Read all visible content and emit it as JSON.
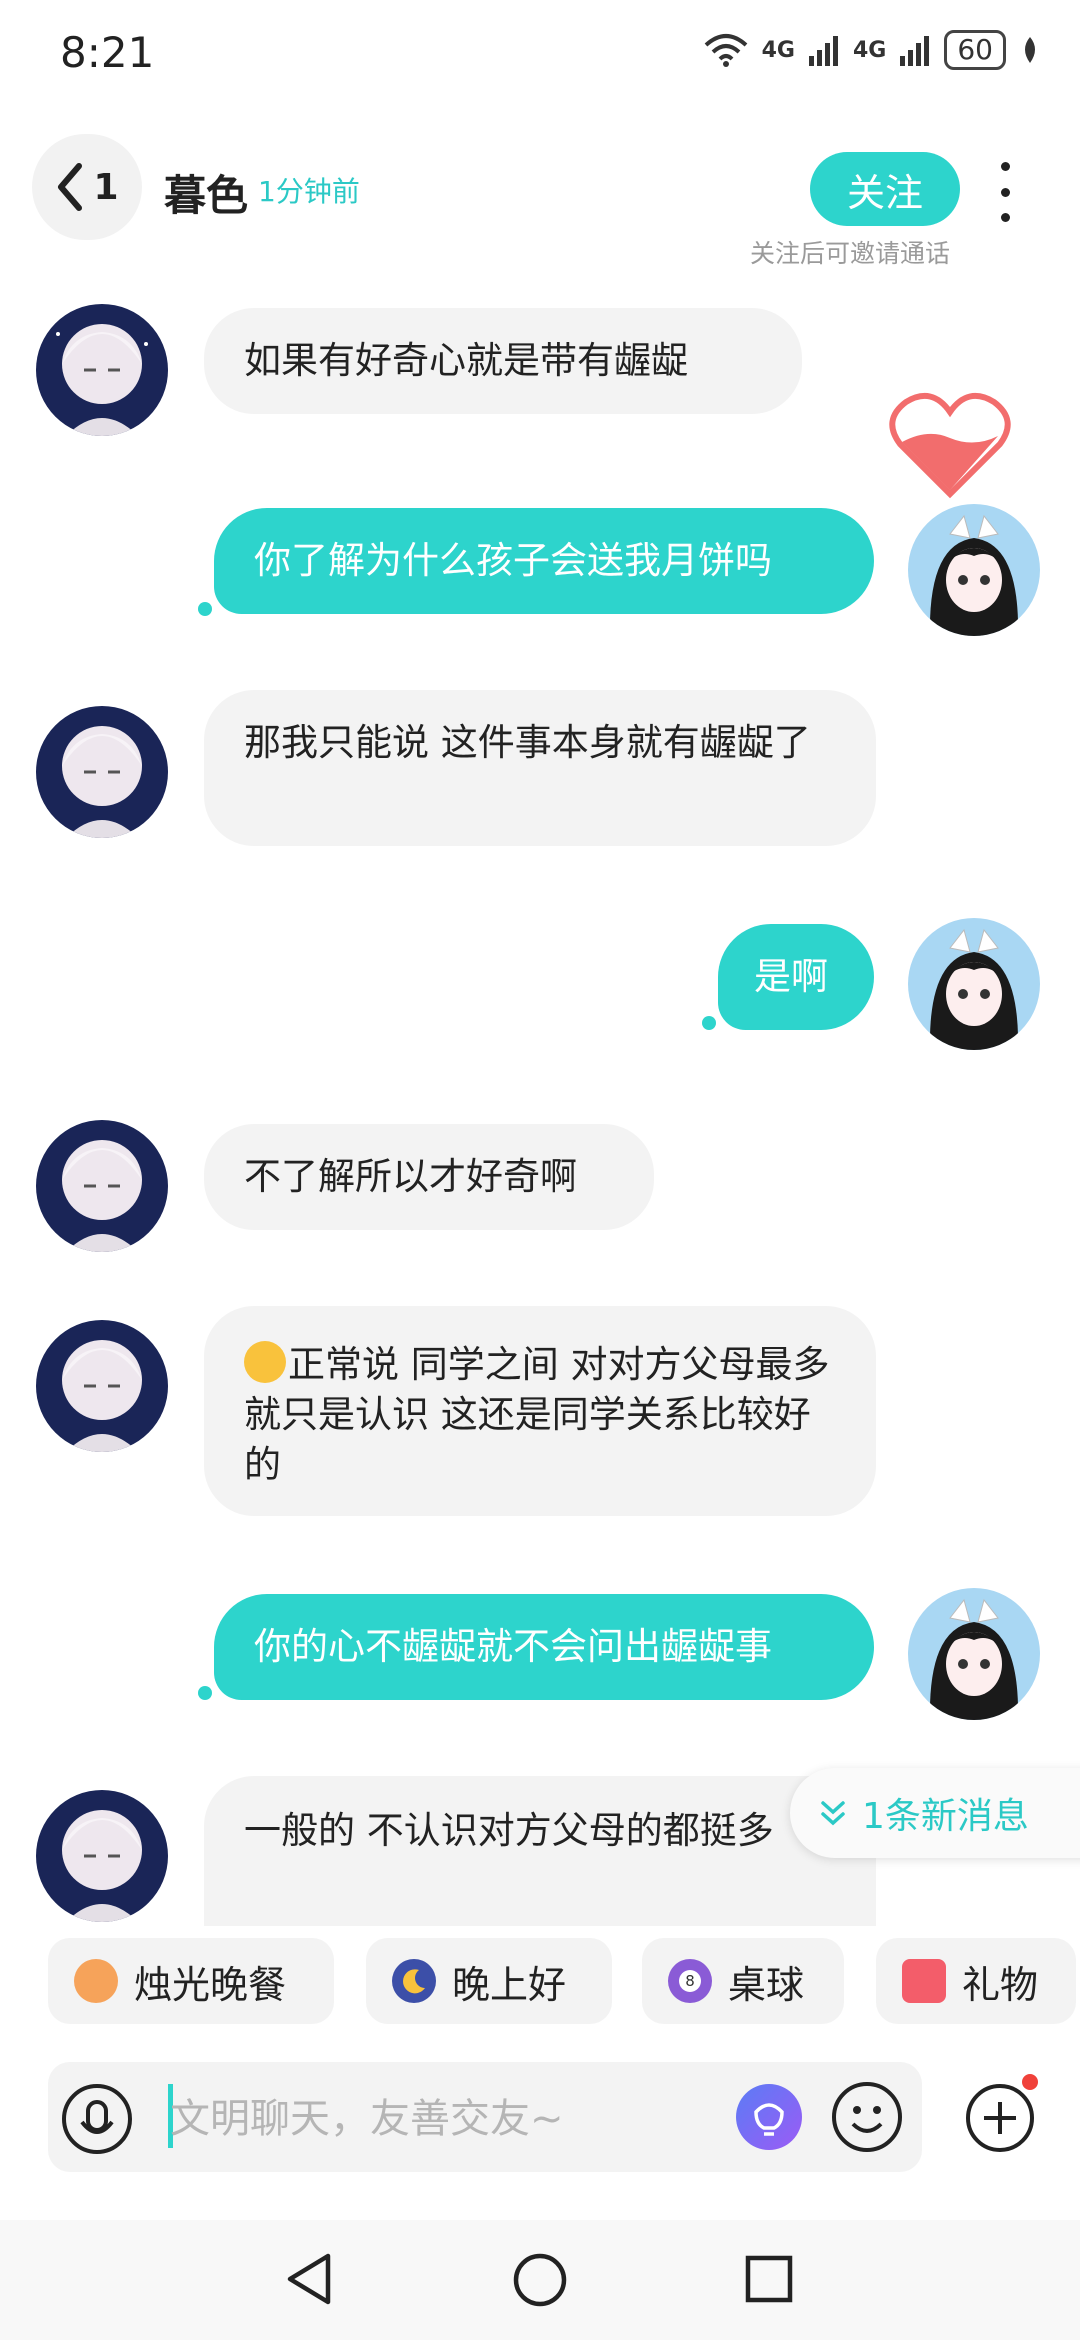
{
  "status_bar": {
    "time": "8:21",
    "net1": "4G",
    "net2": "4G",
    "battery": "60"
  },
  "header": {
    "back_count": "1",
    "title": "暮色",
    "last_seen": "1分钟前",
    "follow_label": "关注",
    "follow_tip": "关注后可邀请通话"
  },
  "messages": [
    {
      "side": "in",
      "text": "如果有好奇心就是带有龌龊"
    },
    {
      "side": "out",
      "text": "你了解为什么孩子会送我月饼吗"
    },
    {
      "side": "in",
      "text": "那我只能说  这件事本身就有龌龊了"
    },
    {
      "side": "out",
      "text": "是啊"
    },
    {
      "side": "in",
      "text": "不了解所以才好奇啊"
    },
    {
      "side": "in",
      "text": "正常说  同学之间  对对方父母最多就只是认识  这还是同学关系比较好的"
    },
    {
      "side": "out",
      "text": "你的心不龌龊就不会问出龌龊事"
    },
    {
      "side": "in",
      "text": "一般的  不认识对方父母的都挺多"
    }
  ],
  "new_message_chip": "1条新消息",
  "quick_chips": [
    {
      "label": "烛光晚餐",
      "icon": "candle-dinner-icon"
    },
    {
      "label": "晚上好",
      "icon": "moon-icon"
    },
    {
      "label": "桌球",
      "icon": "billiard-ball-icon"
    },
    {
      "label": "礼物",
      "icon": "gift-icon"
    }
  ],
  "input": {
    "placeholder": "文明聊天，友善交友~"
  },
  "colors": {
    "accent": "#2dd4cc",
    "bubble_in": "#f3f3f3",
    "heart": "#f26d6d"
  }
}
